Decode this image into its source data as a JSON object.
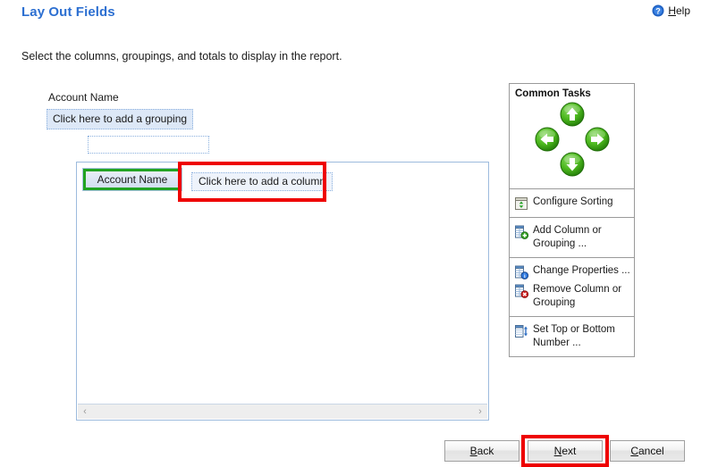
{
  "header": {
    "title": "Lay Out Fields",
    "help": {
      "label": "Help",
      "access_key": "H",
      "rest": "elp",
      "icon": "help-circle-icon"
    }
  },
  "instruction": "Select the columns, groupings, and totals to display in the report.",
  "grouping": {
    "label": "Account Name",
    "add_grouping_text": "Click here to add a grouping",
    "empty_placeholder": ""
  },
  "design_surface": {
    "column_header": "Account Name",
    "add_column_text": "Click here to add a column",
    "scroll_left_glyph": "‹",
    "scroll_right_glyph": "›"
  },
  "common_tasks": {
    "title": "Common Tasks",
    "nav": [
      {
        "name": "move-up",
        "icon": "arrow-up-icon"
      },
      {
        "name": "move-left",
        "icon": "arrow-left-icon"
      },
      {
        "name": "move-right",
        "icon": "arrow-right-icon"
      },
      {
        "name": "move-down",
        "icon": "arrow-down-icon"
      }
    ],
    "sections": [
      {
        "items": [
          {
            "label": "Configure Sorting",
            "icon": "sort-icon"
          }
        ]
      },
      {
        "items": [
          {
            "label": "Add Column or Grouping ...",
            "icon": "add-column-icon"
          }
        ]
      },
      {
        "items": [
          {
            "label": "Change Properties ...",
            "icon": "column-properties-icon"
          },
          {
            "label": "Remove Column or Grouping",
            "icon": "remove-column-icon"
          }
        ]
      },
      {
        "items": [
          {
            "label": "Set Top or Bottom Number ...",
            "icon": "top-bottom-icon"
          }
        ]
      }
    ]
  },
  "footer": {
    "back": {
      "access_key": "B",
      "rest": "ack",
      "label": "Back"
    },
    "next": {
      "access_key": "N",
      "rest": "ext",
      "label": "Next"
    },
    "cancel": {
      "access_key": "C",
      "rest": "ancel",
      "label": "Cancel"
    }
  },
  "colors": {
    "title_blue": "#2c6fd1",
    "highlight_red": "#ee0000",
    "selection_green": "#22a322",
    "panel_border": "#9a9a9a",
    "dotted_blue": "#8ab0de"
  }
}
